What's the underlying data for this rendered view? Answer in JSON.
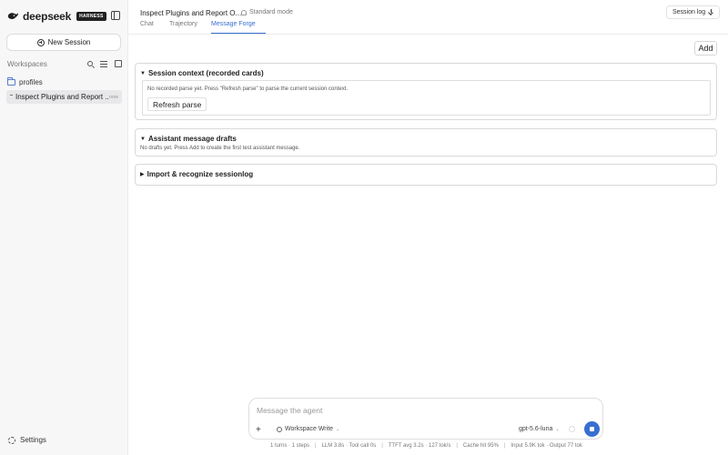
{
  "brand": {
    "name": "deepseek",
    "badge": "HARNESS"
  },
  "sidebar": {
    "new_session_label": "New Session",
    "workspaces_label": "Workspaces",
    "folder_label": "profiles",
    "session_name": "Inspect Plugins and Report ...",
    "session_time": "now",
    "settings_label": "Settings"
  },
  "header": {
    "title": "Inspect Plugins and Report O...",
    "mode": "Standard mode",
    "session_log_label": "Session log",
    "tabs": [
      {
        "label": "Chat"
      },
      {
        "label": "Trajectory"
      },
      {
        "label": "Message Forge"
      }
    ]
  },
  "main": {
    "add_label": "Add",
    "panels": [
      {
        "title": "Session context (recorded cards)",
        "caret": "▼",
        "body": "No recorded parse yet. Press \"Refresh parse\" to parse the current session context.",
        "button": "Refresh parse"
      },
      {
        "title": "Assistant message drafts",
        "caret": "▼",
        "body": "No drafts yet. Press Add to create the first test assistant message."
      },
      {
        "title": "Import & recognize sessionlog",
        "caret": "▶"
      }
    ]
  },
  "composer": {
    "placeholder": "Message the agent",
    "attach": "+",
    "workspace_mode": "Workspace Write",
    "model": "gpt-5.6-luna"
  },
  "status": {
    "turns": "1 turns · 1 steps",
    "llm": "LLM 3.8s · Tool call 0s",
    "ttft": "TTFT avg 3.2s · 127 tok/s",
    "cache": "Cache hit 95%",
    "tokens": "Input 5.9K tok · Output 77 tok"
  },
  "colors": {
    "accent": "#3a6fd0",
    "sidebar_bg": "#f7f7f8"
  }
}
